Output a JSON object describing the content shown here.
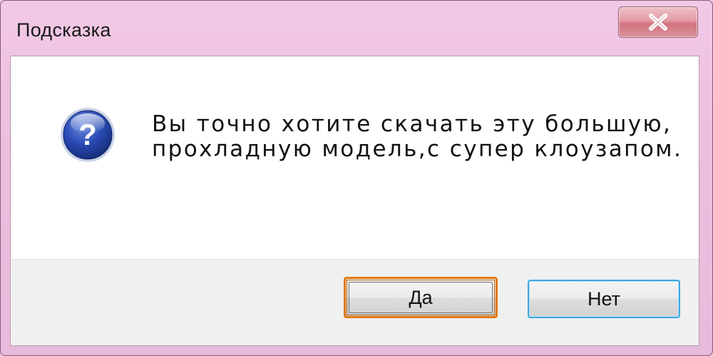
{
  "window": {
    "title": "Подсказка"
  },
  "dialog": {
    "icon": "question-icon",
    "message_lines": [
      "Вы точно хотите скачать эту большую,",
      "прохладную модель,с супер клоузапом."
    ]
  },
  "buttons": {
    "yes_label": "Да",
    "no_label": "Нет"
  },
  "colors": {
    "frame": "#ecbfdf",
    "close_button": "#d07480",
    "default_button_border": "#e07a10",
    "focus_button_border": "#3aa6e0",
    "icon_blue": "#1d3fa0"
  }
}
